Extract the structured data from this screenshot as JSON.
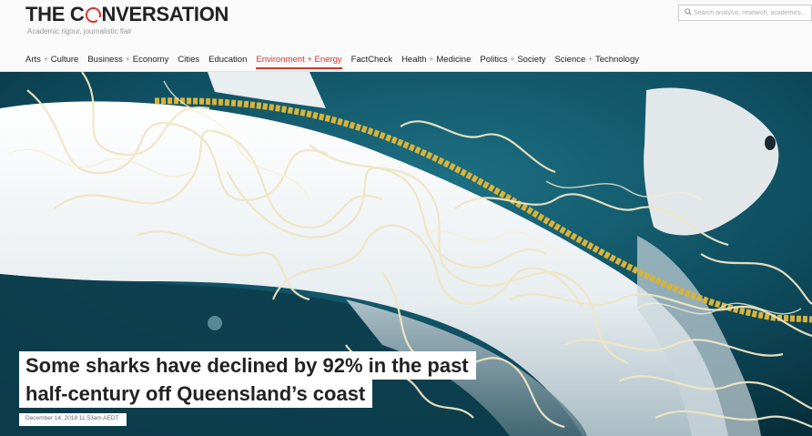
{
  "header": {
    "logo_before": "THE C",
    "logo_after": "NVERSATION",
    "tagline": "Academic rigour, journalistic flair",
    "search_placeholder": "Search analysis, research, academics…",
    "search_icon": "search-icon"
  },
  "nav": [
    {
      "a": "Arts",
      "b": "Culture",
      "active": false
    },
    {
      "a": "Business",
      "b": "Economy",
      "active": false
    },
    {
      "a": "Cities",
      "b": "",
      "active": false
    },
    {
      "a": "Education",
      "b": "",
      "active": false
    },
    {
      "a": "Environment",
      "b": "Energy",
      "active": true
    },
    {
      "a": "FactCheck",
      "b": "",
      "active": false
    },
    {
      "a": "Health",
      "b": "Medicine",
      "active": false
    },
    {
      "a": "Politics",
      "b": "Society",
      "active": false
    },
    {
      "a": "Science",
      "b": "Technology",
      "active": false
    }
  ],
  "article": {
    "title_line1": "Some sharks have declined by 92% in the past",
    "title_line2": "half-century off Queensland’s coast",
    "date": "December 14, 2018 11.53am AEDT"
  },
  "colors": {
    "accent": "#d8352a",
    "ocean": "#0b4353"
  }
}
